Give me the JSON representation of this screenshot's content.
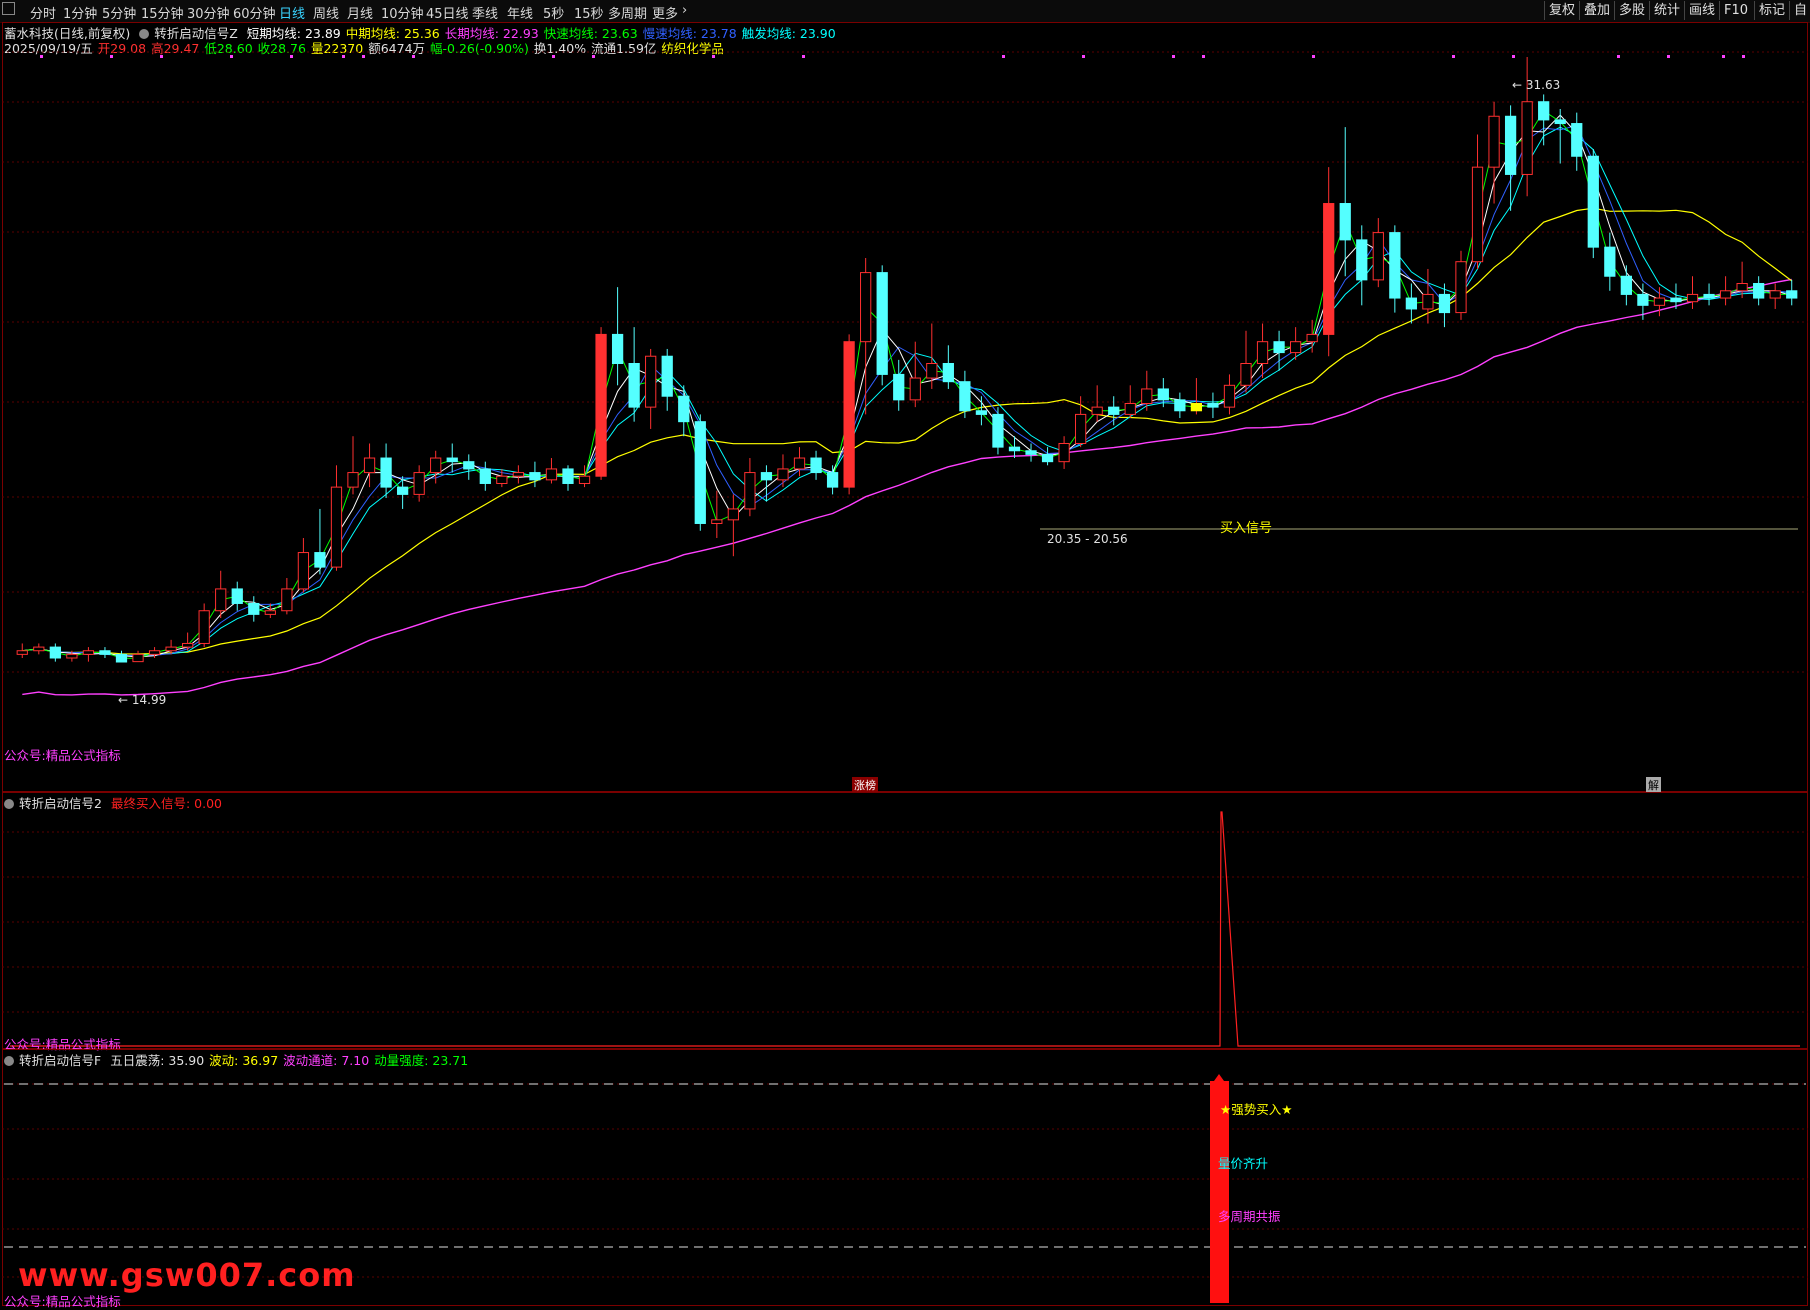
{
  "toolbar": {
    "periods": [
      "分时",
      "1分钟",
      "5分钟",
      "15分钟",
      "30分钟",
      "60分钟",
      "日线",
      "周线",
      "月线",
      "10分钟",
      "45日线",
      "季线",
      "年线",
      "5秒",
      "15秒",
      "多周期",
      "更多"
    ],
    "active": "日线",
    "right_buttons": [
      "复权",
      "叠加",
      "多股",
      "统计",
      "画线",
      "F10",
      "标记"
    ],
    "right_edge": "自"
  },
  "header": {
    "stock": "蓄水科技(日线,前复权)",
    "indicator": "转折启动信号Z",
    "ma_labels": [
      {
        "label": "短期均线: 23.89",
        "color": "#ffffff"
      },
      {
        "label": "中期均线: 25.36",
        "color": "#ffff00"
      },
      {
        "label": "长期均线: 22.93",
        "color": "#ff40ff"
      },
      {
        "label": "快速均线: 23.63",
        "color": "#00ff00"
      },
      {
        "label": "慢速均线: 23.78",
        "color": "#3060ff"
      },
      {
        "label": "触发均线: 23.90",
        "color": "#00ffff"
      }
    ],
    "quote": [
      {
        "label": "2025/09/19/五",
        "color": "#e0e0e0"
      },
      {
        "label": "开29.08",
        "color": "#ff3030"
      },
      {
        "label": "高29.47",
        "color": "#ff3030"
      },
      {
        "label": "低28.60",
        "color": "#00ff00"
      },
      {
        "label": "收28.76",
        "color": "#00ff00"
      },
      {
        "label": "量22370",
        "color": "#ffff00"
      },
      {
        "label": "额6474万",
        "color": "#e0e0e0"
      },
      {
        "label": "幅-0.26(-0.90%)",
        "color": "#00ff00"
      },
      {
        "label": "换1.40%",
        "color": "#e0e0e0"
      },
      {
        "label": "流通1.59亿",
        "color": "#e0e0e0"
      },
      {
        "label": "纺织化学品",
        "color": "#ffff00"
      }
    ]
  },
  "main_chart": {
    "high_label": "31.63",
    "low_label": "14.99",
    "range_label": "20.35 - 20.56",
    "buy_label": "买入信号",
    "bottom_tag_left": "涨榜",
    "bottom_tag_right": "解",
    "watermark": "公众号:精品公式指标",
    "colors": {
      "up": "#ff3030",
      "down": "#54ffff",
      "white": "#ffffff",
      "ma_mid": "#ffff00",
      "ma_long": "#ff40ff",
      "fast": "#00ff00",
      "slow": "#3060ff",
      "trigger": "#00ffff"
    }
  },
  "pane2": {
    "indicator": "转折启动信号2",
    "field": "最终买入信号: 0.00",
    "watermark": "公众号:精品公式指标"
  },
  "pane3": {
    "indicator": "转折启动信号F",
    "fields": [
      {
        "label": "五日震荡: 35.90",
        "color": "#e0e0e0"
      },
      {
        "label": "波动: 36.97",
        "color": "#ffff00"
      },
      {
        "label": "波动通道: 7.10",
        "color": "#ff40ff"
      },
      {
        "label": "动量强度: 23.71",
        "color": "#00ff00"
      }
    ],
    "signal_labels": [
      {
        "label": "★强势买入★",
        "color": "#ffff00"
      },
      {
        "label": "量价齐升",
        "color": "#00ffff"
      },
      {
        "label": "多周期共振",
        "color": "#ff40ff"
      }
    ],
    "watermark": "公众号:精品公式指标"
  },
  "site": "www.gsw007.com"
}
